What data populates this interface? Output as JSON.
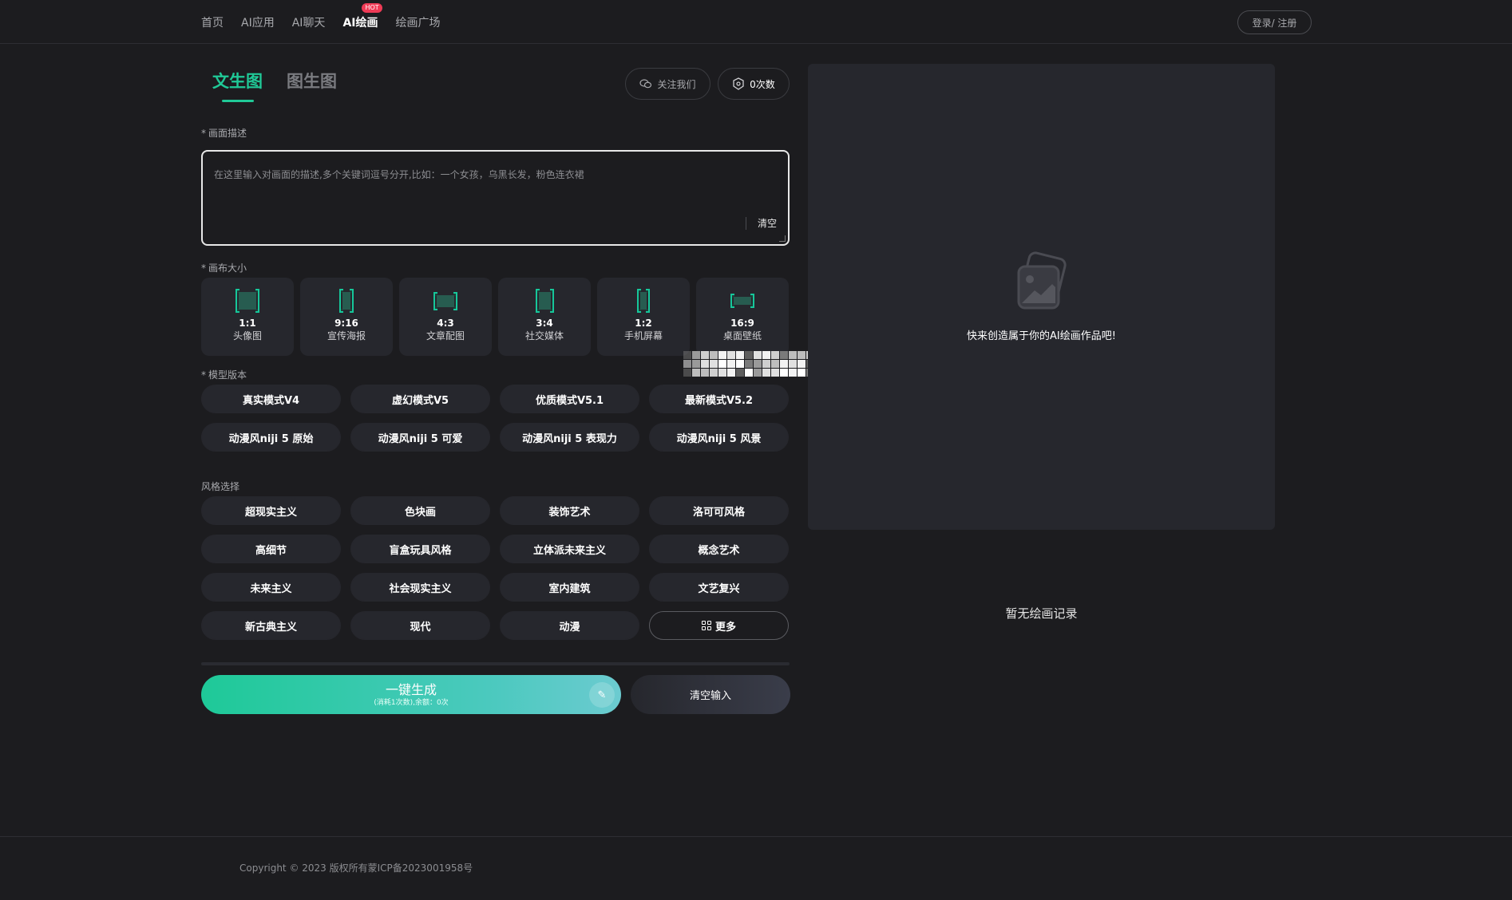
{
  "nav": {
    "items": [
      {
        "label": "首页"
      },
      {
        "label": "AI应用"
      },
      {
        "label": "AI聊天"
      },
      {
        "label": "AI绘画",
        "badge": "HOT"
      },
      {
        "label": "绘画广场"
      }
    ],
    "login_label": "登录/ 注册"
  },
  "tabs": [
    "文生图",
    "图生图"
  ],
  "header_buttons": {
    "follow_label": "关注我们",
    "credits_label": "0次数"
  },
  "prompt": {
    "label": "画面描述",
    "placeholder": "在这里输入对画面的描述,多个关键词逗号分开,比如：一个女孩，乌黑长发，粉色连衣裙",
    "clear_label": "清空"
  },
  "canvas": {
    "label": "画布大小",
    "sizes": [
      {
        "ratio": "1:1",
        "desc": "头像图"
      },
      {
        "ratio": "9:16",
        "desc": "宣传海报"
      },
      {
        "ratio": "4:3",
        "desc": "文章配图"
      },
      {
        "ratio": "3:4",
        "desc": "社交媒体"
      },
      {
        "ratio": "1:2",
        "desc": "手机屏幕"
      },
      {
        "ratio": "16:9",
        "desc": "桌面壁纸"
      }
    ]
  },
  "model": {
    "label": "模型版本",
    "options": [
      "真实模式V4",
      "虚幻模式V5",
      "优质模式V5.1",
      "最新模式V5.2",
      "动漫风niji 5 原始",
      "动漫风niji 5 可爱",
      "动漫风niji 5 表现力",
      "动漫风niji 5 风景"
    ]
  },
  "style": {
    "label": "风格选择",
    "options": [
      "超现实主义",
      "色块画",
      "装饰艺术",
      "洛可可风格",
      "高细节",
      "盲盒玩具风格",
      "立体派未来主义",
      "概念艺术",
      "未来主义",
      "社会现实主义",
      "室内建筑",
      "文艺复兴",
      "新古典主义",
      "现代",
      "动漫"
    ],
    "more_label": "更多"
  },
  "actions": {
    "generate_label": "一键生成",
    "generate_sub": "(消耗1次数),余额：0次",
    "reset_label": "清空输入"
  },
  "preview": {
    "empty_message": "快来创造属于你的AI绘画作品吧!"
  },
  "history": {
    "empty_message": "暂无绘画记录"
  },
  "footer": {
    "copyright": "Copyright © 2023 版权所有蒙ICP备2023001958号"
  },
  "colors": {
    "accent": "#20c997",
    "background": "#1c1c1f",
    "card": "#26272d",
    "hot_badge": "#ef3b56"
  }
}
